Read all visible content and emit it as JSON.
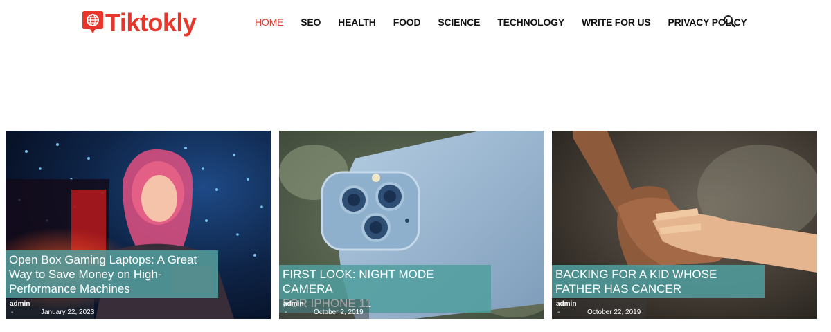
{
  "site": {
    "logo_text": "Tiktokly",
    "logo_icon": "globe-chat-icon",
    "accent_color": "#e8362a"
  },
  "nav": {
    "items": [
      {
        "label": "HOME",
        "active": true
      },
      {
        "label": "SEO",
        "active": false
      },
      {
        "label": "HEALTH",
        "active": false
      },
      {
        "label": "FOOD",
        "active": false
      },
      {
        "label": "SCIENCE",
        "active": false
      },
      {
        "label": "TECHNOLOGY",
        "active": false
      },
      {
        "label": "WRITE FOR US",
        "active": false
      },
      {
        "label": "PRIVACY POLICY",
        "active": false
      }
    ],
    "search_icon": "search-icon"
  },
  "posts": [
    {
      "title": "Open Box Gaming Laptops: A Great Way to Save Money on High-Performance Machines",
      "title_lines": [
        "Open Box Gaming Laptops: A Great",
        "Way to Save Money on High-",
        "Performance Machines"
      ],
      "author": "admin",
      "separator": "-",
      "date": "January 22, 2023"
    },
    {
      "title": "FIRST LOOK: NIGHT MODE CAMERA FOR IPHONE 11",
      "title_lines": [
        "FIRST LOOK: NIGHT MODE CAMERA",
        "FOR IPHONE 11"
      ],
      "author": "admin",
      "separator": "-",
      "date": "October 2, 2019"
    },
    {
      "title": "BACKING FOR A KID WHOSE FATHER HAS CANCER",
      "title_lines": [
        "BACKING FOR A KID WHOSE",
        "FATHER HAS CANCER"
      ],
      "author": "admin",
      "separator": "-",
      "date": "October 22, 2019"
    }
  ],
  "colors": {
    "title_overlay": "#509e9e",
    "meta_overlay": "#3c3c3c"
  }
}
